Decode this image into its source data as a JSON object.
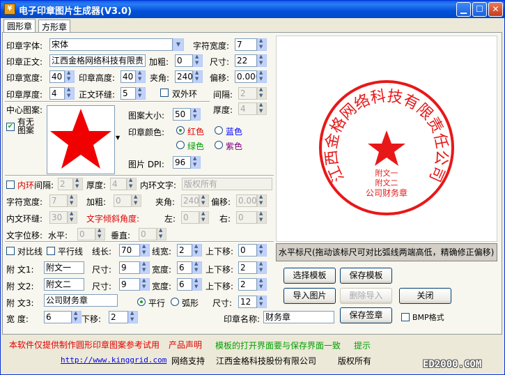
{
  "window": {
    "title": "电子印章图片生成器(V3.0)",
    "app_icon": "¥",
    "accent": "#0051d8"
  },
  "tabs": [
    {
      "label": "圆形章"
    },
    {
      "label": "方形章"
    }
  ],
  "seal": {
    "font_label": "印章字体:",
    "font_value": "宋体",
    "char_width_label": "字符宽度:",
    "char_width_value": "7",
    "main_text_label": "印章正文:",
    "main_text_value": "江西金格网络科技有限责",
    "bold_label": "加粗:",
    "bold_value": "0",
    "size_label": "尺寸:",
    "size_value": "22",
    "width_label": "印章宽度:",
    "width_value": "40",
    "height_label": "印章高度:",
    "height_value": "40",
    "angle_label": "夹角:",
    "angle_value": "240",
    "offset_label": "偏移:",
    "offset_value": "0.000",
    "thickness_label": "印章厚度:",
    "thickness_value": "4",
    "ring_label": "正文环缝:",
    "ring_value": "5",
    "double_ring_label": "双外环",
    "gap_label": "间隔:",
    "gap_value": "2",
    "outer_thick_label": "厚度:",
    "outer_thick_value": "4"
  },
  "center": {
    "label": "中心图案:",
    "has_label_1": "有无",
    "has_label_2": "图案",
    "has_checked": "✔",
    "pattern_size_label": "图案大小:",
    "pattern_size_value": "50",
    "color_label": "印章颜色:",
    "color_red": "红色",
    "color_blue": "蓝色",
    "color_green": "绿色",
    "color_purple": "紫色",
    "dpi_label": "图片 DPI:",
    "dpi_value": "96",
    "star_color": "#f00000"
  },
  "inner": {
    "ring_prefix": "内环",
    "ring_label": "间隔:",
    "ring_value": "2",
    "thick_label": "厚度:",
    "thick_value": "4",
    "text_label": "内环文字:",
    "text_value": "版权所有",
    "char_width_label": "字符宽度:",
    "char_width_value": "7",
    "bold_label": "加粗:",
    "bold_value": "0",
    "angle_label": "夹角:",
    "angle_value": "240",
    "offset_label": "偏移:",
    "offset_value": "0.000",
    "ring_gap_label": "内文环缝:",
    "ring_gap_value": "30",
    "tilt_label": "文字倾斜角度:",
    "left_label": "左:",
    "left_value": "0",
    "right_label": "右:",
    "right_value": "0",
    "shift_label": "文字位移:",
    "h_label": "水平:",
    "h_value": "0",
    "v_label": "垂直:",
    "v_value": "0"
  },
  "lines": {
    "compare_label": "对比线",
    "parallel_label": "平行线",
    "len_label": "线长:",
    "len_value": "70",
    "lw_label": "线宽:",
    "lw_value": "2",
    "ud_label": "上下移:",
    "ud_value": "0"
  },
  "attach": {
    "t1_label": "附   文1:",
    "t1_value": "附文一",
    "t1_size_label": "尺寸:",
    "t1_size": "9",
    "t1_w_label": "宽度:",
    "t1_w": "6",
    "t1_ud_label": "上下移:",
    "t1_ud": "2",
    "t2_label": "附   文2:",
    "t2_value": "附文二",
    "t2_size_label": "尺寸:",
    "t2_size": "9",
    "t2_w_label": "宽度:",
    "t2_w": "6",
    "t2_ud_label": "上下移:",
    "t2_ud": "2",
    "t3_label": "附   文3:",
    "t3_value": "公司财务章",
    "parallel": "平行",
    "arc": "弧形",
    "t3_size_label": "尺寸:",
    "t3_size": "12",
    "width_label": "宽   度:",
    "width_value": "6",
    "down_label": "下移:",
    "down_value": "2",
    "name_label": "印章名称:",
    "name_value": "财务章"
  },
  "preview": {
    "seal_text": "江西金格网络科技有限责任公司",
    "line1": "附文一",
    "line2": "附文二",
    "line3": "公司财务章",
    "hint": "水平标尺(拖动该标尺可对比弧线两端高低，精确修正偏移)"
  },
  "buttons": {
    "select_template": "选择模板",
    "save_template": "保存模板",
    "import_image": "导入图片",
    "delete_import": "删除导入",
    "close": "关闭",
    "save_seal": "保存签章",
    "bmp_label": "BMP格式"
  },
  "footer": {
    "disclaimer": "本软件仅提供制作圆形印章图案参考试用",
    "statement": "产品声明",
    "template_note": "模板的打开界面要与保存界面一致",
    "tip": "提示",
    "url": "http://www.kinggrid.com",
    "support": "网络支持",
    "company": "江西金格科技股份有限公司",
    "rights": "版权所有",
    "watermark": "ED2000.COM"
  }
}
